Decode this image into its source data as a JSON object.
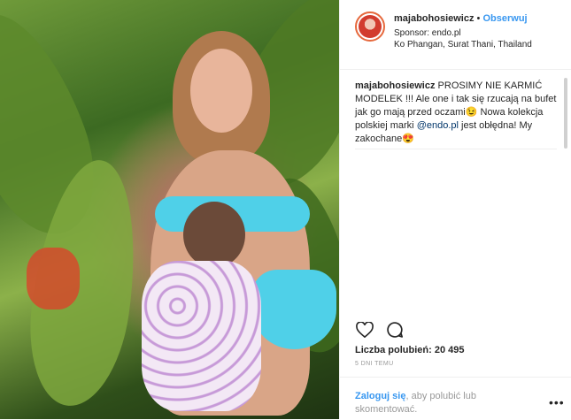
{
  "header": {
    "username": "majabohosiewicz",
    "separator": "•",
    "follow_label": "Obserwuj",
    "sponsor": "Sponsor: endo.pl",
    "location": "Ko Phangan, Surat Thani, Thailand"
  },
  "caption": {
    "username": "majabohosiewicz",
    "text_1": "PROSIMY NIE KARMIĆ MODELEK !!! Ale one i tak się rzucają na bufet jak go mają przed oczami",
    "emoji_1": "😉",
    "text_2": " Nowa kolekcja polskiej marki ",
    "mention": "@endo.pl",
    "text_3": " jest obłędna! My zakochane",
    "emoji_2": "😍"
  },
  "actions": {
    "like_icon": "heart-icon",
    "comment_icon": "comment-icon"
  },
  "likes": "Liczba polubień: 20 495",
  "timestamp": "5 DNI TEMU",
  "footer": {
    "login_link": "Zaloguj się",
    "login_rest": ", aby polubić lub skomentować.",
    "more_label": "•••"
  },
  "colors": {
    "accent": "#3897f0",
    "text": "#262626",
    "muted": "#999999"
  }
}
